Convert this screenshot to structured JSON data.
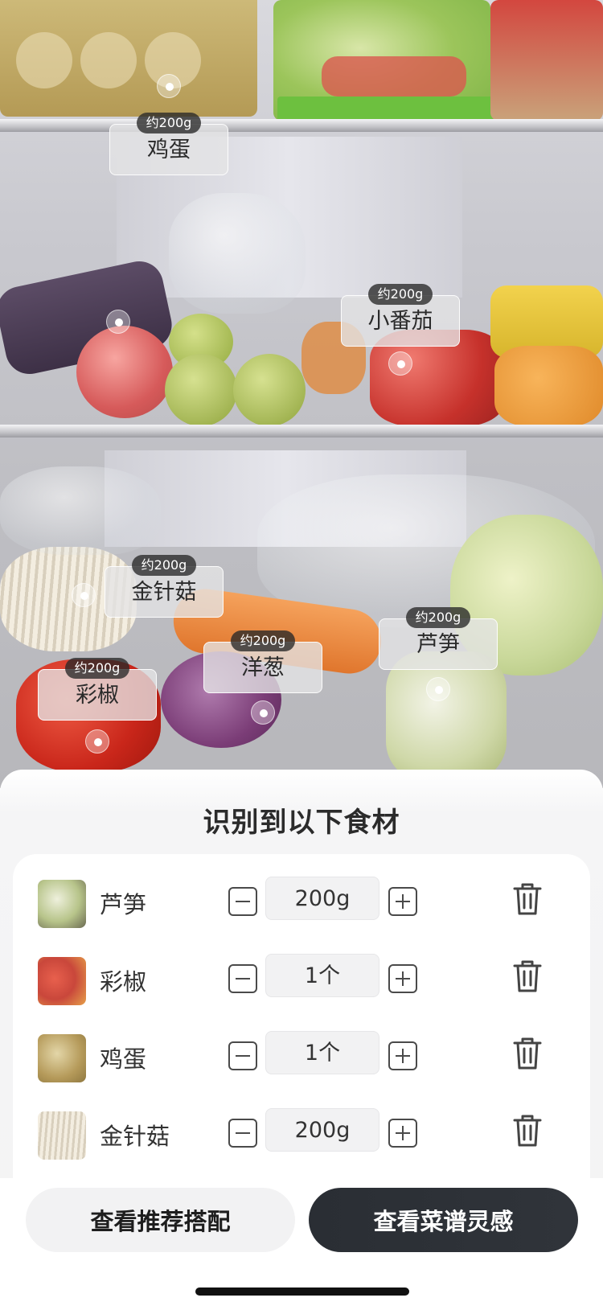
{
  "photo_markers": [
    {
      "id": "egg",
      "weight": "约200g",
      "name": "鸡蛋"
    },
    {
      "id": "cherry-tomato",
      "weight": "约200g",
      "name": "小番茄"
    },
    {
      "id": "enoki",
      "weight": "约200g",
      "name": "金针菇"
    },
    {
      "id": "asparagus",
      "weight": "约200g",
      "name": "芦笋"
    },
    {
      "id": "onion",
      "weight": "约200g",
      "name": "洋葱"
    },
    {
      "id": "pepper",
      "weight": "约200g",
      "name": "彩椒"
    }
  ],
  "sheet": {
    "title": "识别到以下食材",
    "items": [
      {
        "name": "芦笋",
        "qty": "200g",
        "thumb_color": "#b7c48a"
      },
      {
        "name": "彩椒",
        "qty": "1个",
        "thumb_color": "#c9473b"
      },
      {
        "name": "鸡蛋",
        "qty": "1个",
        "thumb_color": "#b59a5a"
      },
      {
        "name": "金针菇",
        "qty": "200g",
        "thumb_color": "#e4dfd2"
      }
    ]
  },
  "footer": {
    "secondary_button": "查看推荐搭配",
    "primary_button": "查看菜谱灵感"
  },
  "icons": {
    "minus": "minus-icon",
    "plus": "plus-icon",
    "trash": "trash-icon"
  }
}
